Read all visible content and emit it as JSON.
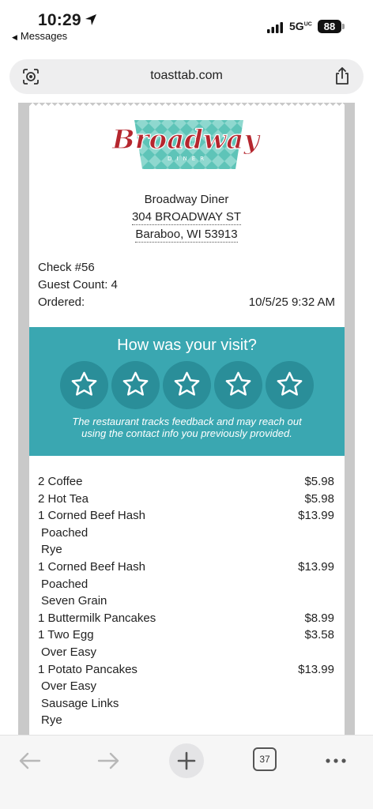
{
  "status_bar": {
    "time": "10:29",
    "back_app": "Messages",
    "network": "5G",
    "network_sup": "UC",
    "battery": "88"
  },
  "browser": {
    "url": "toasttab.com",
    "tab_count": "37"
  },
  "restaurant": {
    "logo_text": "Broadway",
    "logo_subtext": "DINER",
    "name": "Broadway Diner",
    "address_line1": "304 BROADWAY ST",
    "address_line2": "Baraboo, WI 53913"
  },
  "check": {
    "number": "Check #56",
    "guest_count": "Guest Count: 4",
    "ordered_label": "Ordered:",
    "ordered_date": "10/5/25 9:32 AM"
  },
  "feedback": {
    "title": "How was your visit?",
    "rating": 0,
    "max_rating": 5,
    "note_line1": "The restaurant tracks feedback and may reach out",
    "note_line2": "using the contact info you previously provided."
  },
  "items": [
    {
      "desc": "2 Coffee",
      "price": "$5.98"
    },
    {
      "desc": "2 Hot Tea",
      "price": "$5.98"
    },
    {
      "desc": "1 Corned Beef Hash",
      "price": "$13.99"
    },
    {
      "desc": "Poached",
      "price": "",
      "modifier": true
    },
    {
      "desc": "Rye",
      "price": "",
      "modifier": true
    },
    {
      "desc": "1 Corned Beef Hash",
      "price": "$13.99"
    },
    {
      "desc": "Poached",
      "price": "",
      "modifier": true
    },
    {
      "desc": "Seven Grain",
      "price": "",
      "modifier": true
    },
    {
      "desc": "1 Buttermilk Pancakes",
      "price": "$8.99"
    },
    {
      "desc": "1 Two Egg",
      "price": "$3.58"
    },
    {
      "desc": "Over Easy",
      "price": "",
      "modifier": true
    },
    {
      "desc": "1 Potato Pancakes",
      "price": "$13.99"
    },
    {
      "desc": "Over Easy",
      "price": "",
      "modifier": true
    },
    {
      "desc": "Sausage Links",
      "price": "",
      "modifier": true
    },
    {
      "desc": "Rye",
      "price": "",
      "modifier": true
    }
  ],
  "colors": {
    "feedback_bg": "#3aa7b1",
    "star_bg": "#2a8e99",
    "logo_red": "#b5262e",
    "logo_teal": "#5ec4b8"
  },
  "icons": {
    "location": "location-arrow-icon",
    "signal": "cellular-signal-icon",
    "page_settings": "page-settings-icon",
    "share": "share-icon",
    "back": "back-arrow-icon",
    "forward": "forward-arrow-icon",
    "new_tab": "plus-icon",
    "tabs": "tabs-icon",
    "more": "more-icon",
    "star": "star-icon"
  }
}
